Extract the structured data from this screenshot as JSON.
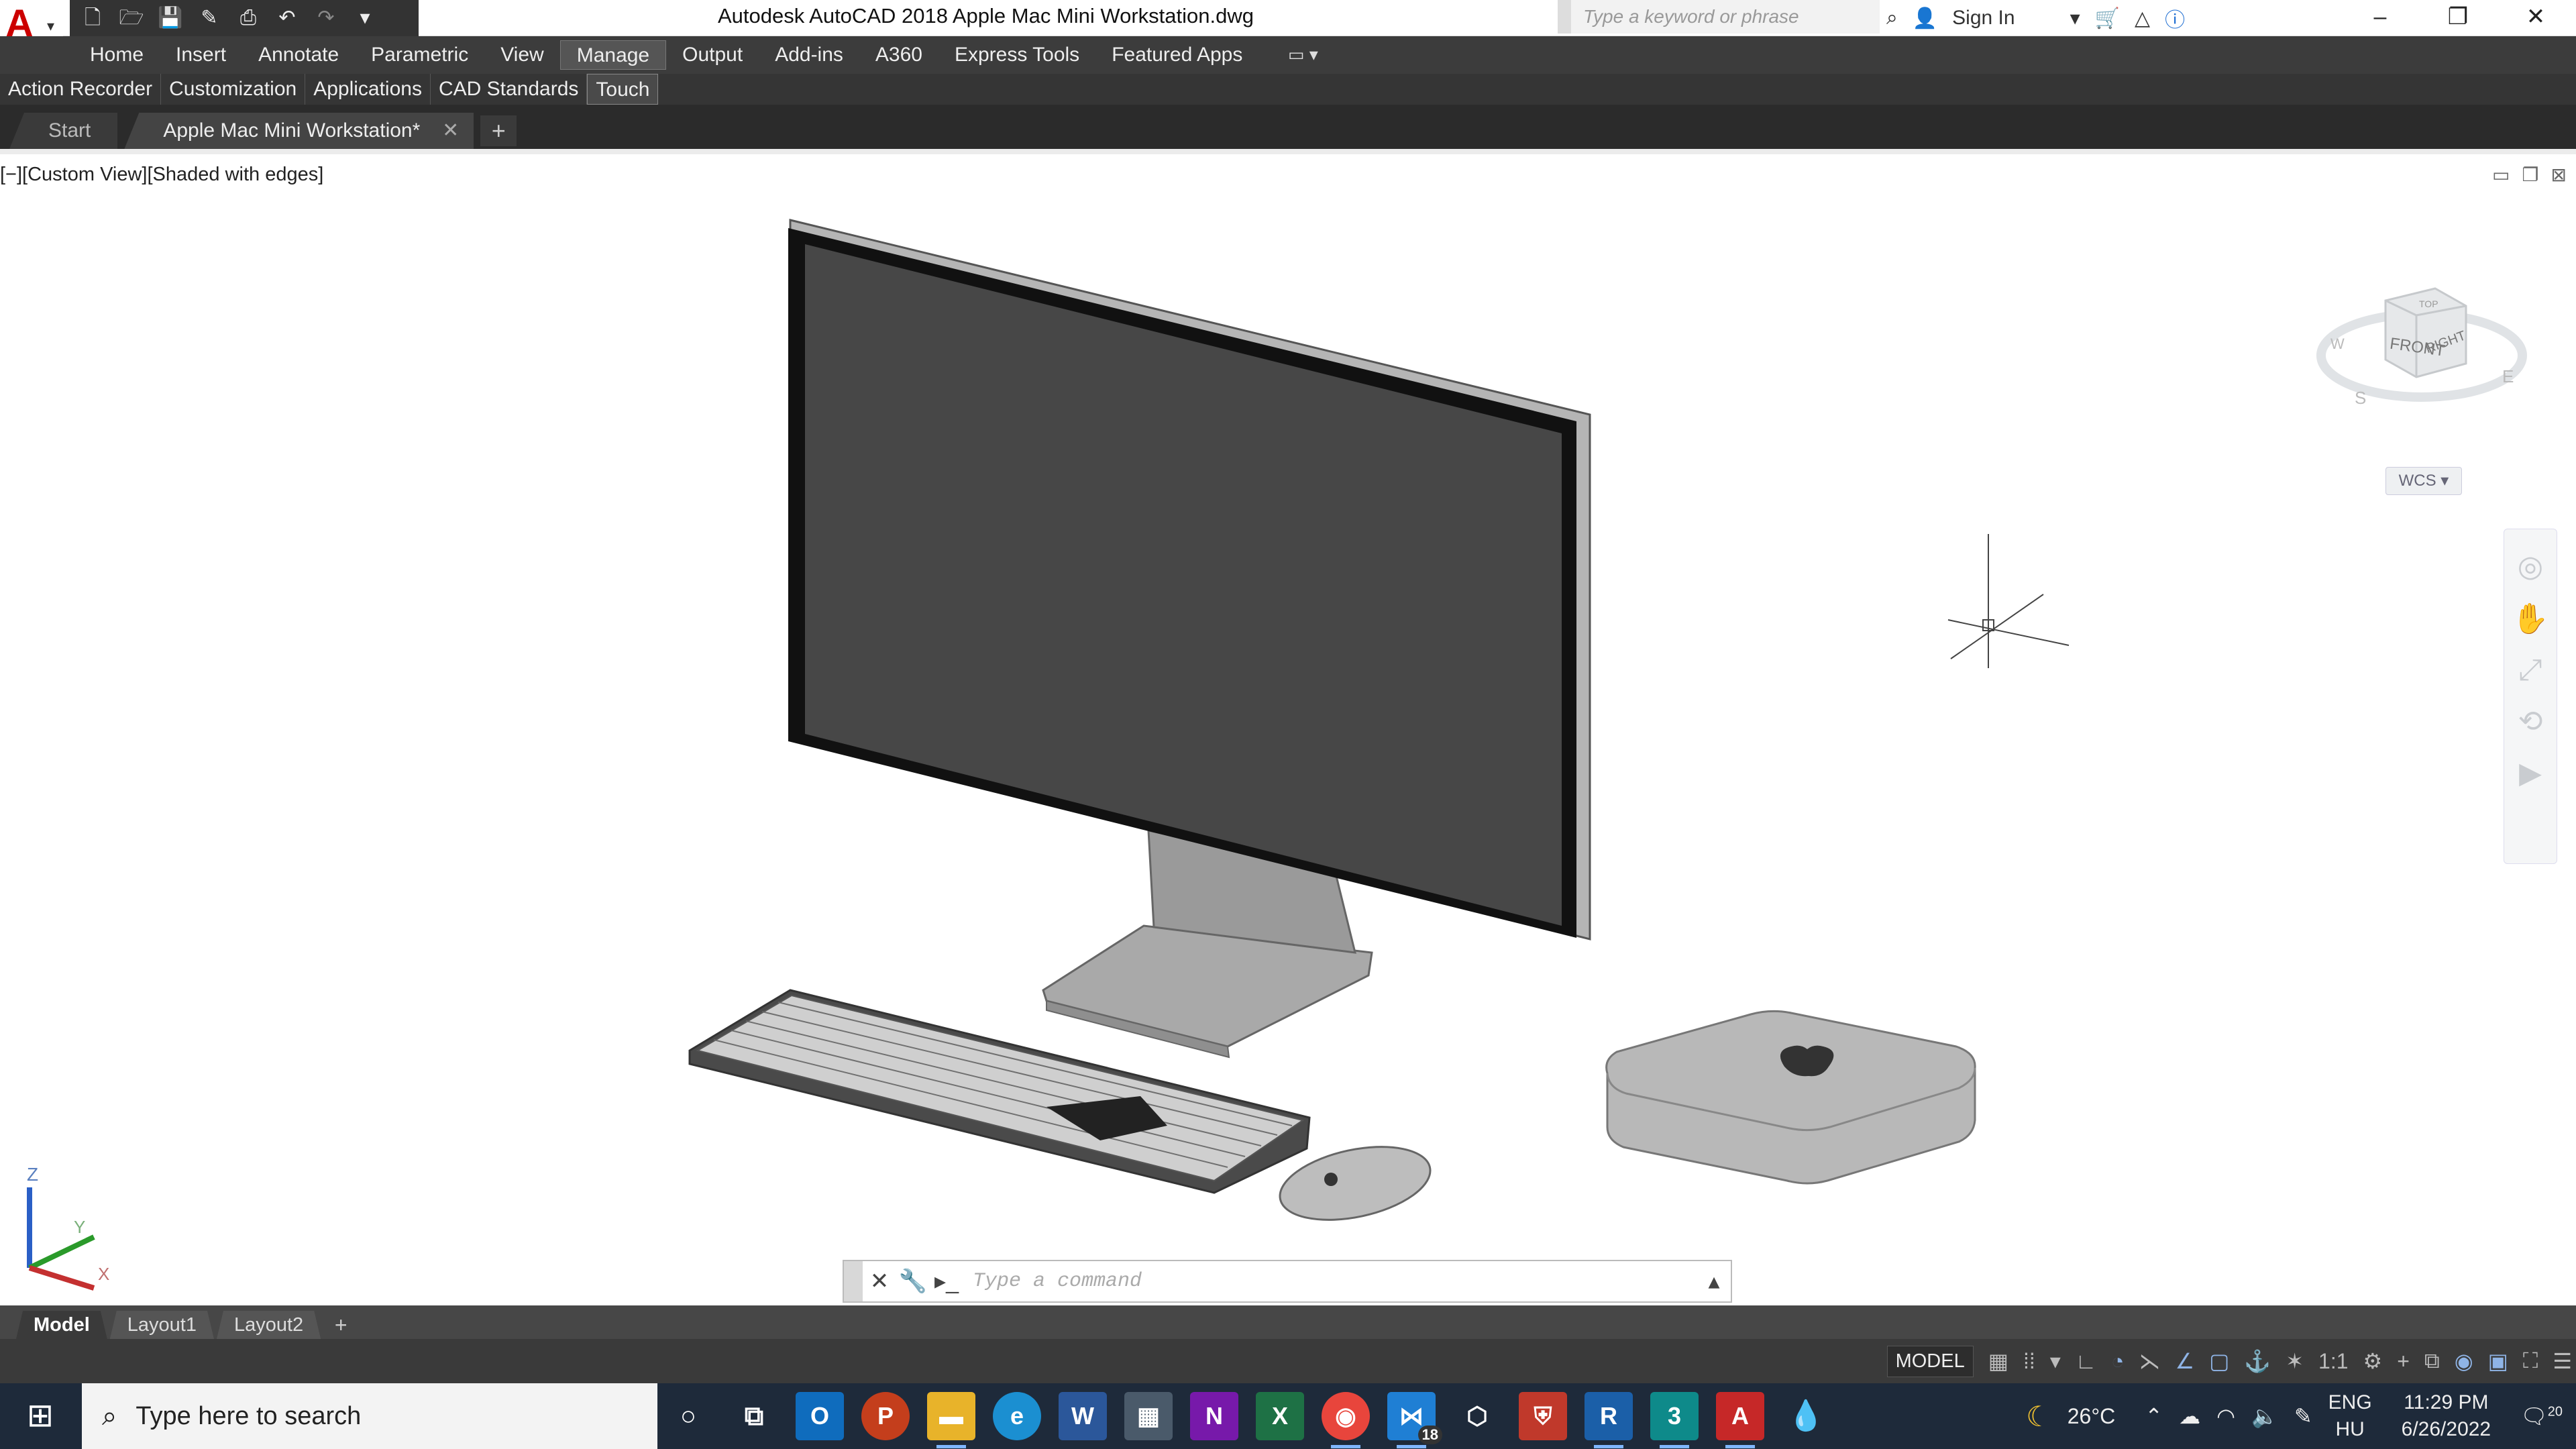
{
  "titlebar": {
    "app_letter": "A",
    "title": "Autodesk AutoCAD 2018    Apple Mac Mini Workstation.dwg",
    "search_placeholder": "Type a keyword or phrase",
    "sign_in": "Sign In"
  },
  "ribbon": {
    "tabs": [
      "Home",
      "Insert",
      "Annotate",
      "Parametric",
      "View",
      "Manage",
      "Output",
      "Add-ins",
      "A360",
      "Express Tools",
      "Featured Apps"
    ],
    "active_tab": "Manage",
    "panels": [
      "Action Recorder",
      "Customization",
      "Applications",
      "CAD Standards",
      "Touch"
    ],
    "active_panel": "Touch"
  },
  "file_tabs": {
    "start": "Start",
    "drawing": "Apple Mac Mini Workstation*"
  },
  "viewport": {
    "label": "[−][Custom View][Shaded with edges]",
    "viewcube": {
      "top": "TOP",
      "front": "FRONT",
      "right": "RIGHT",
      "compass_w": "W",
      "compass_s": "S",
      "compass_e": "E"
    },
    "wcs": "WCS",
    "ucs": {
      "z": "Z",
      "y": "Y",
      "x": "X"
    }
  },
  "command_line": {
    "placeholder": "Type a command"
  },
  "layout_tabs": [
    "Model",
    "Layout1",
    "Layout2"
  ],
  "status_bar": {
    "model": "MODEL",
    "scale": "1:1"
  },
  "taskbar": {
    "search_placeholder": "Type here to search",
    "badge": "18",
    "weather": "26°C",
    "lang1": "ENG",
    "lang2": "HU",
    "time": "11:29 PM",
    "date": "6/26/2022",
    "notifications": "20",
    "apps": [
      "outlook-icon",
      "powerpoint-icon",
      "file-explorer-icon",
      "edge-icon",
      "word-icon",
      "calculator-icon",
      "onenote-icon",
      "excel-icon",
      "chrome-icon",
      "vscode-icon",
      "3d-viewer-icon",
      "security-icon",
      "revit-icon",
      "3dsmax-icon",
      "autocad-icon",
      "paint-icon"
    ]
  },
  "colors": {
    "autocad_red": "#cc0000",
    "ribbon_bg": "#3c3c3c",
    "taskbar_bg": "#1e2a3a"
  }
}
